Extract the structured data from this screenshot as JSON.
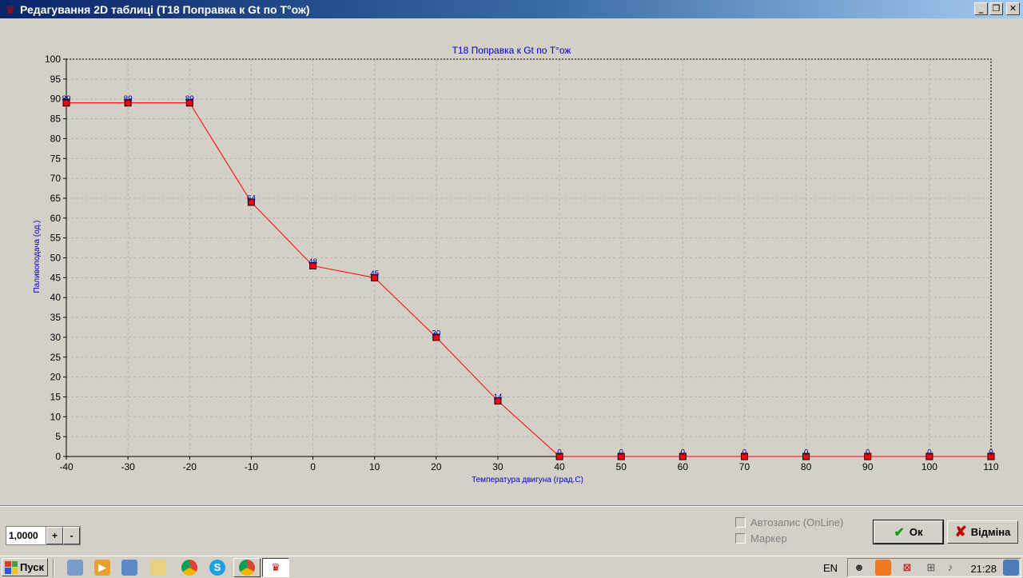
{
  "window": {
    "title": "Редагування 2D таблиці (T18 Поправка к Gt по T°ож)",
    "minimize_label": "_",
    "restore_label": "❐",
    "close_label": "✕"
  },
  "chart_data": {
    "type": "line",
    "title": "T18 Поправка к Gt по T°ож",
    "xlabel": "Температура двигуна (град.C)",
    "ylabel": "Паливоподача (од.)",
    "x": [
      -40,
      -30,
      -20,
      -10,
      0,
      10,
      20,
      30,
      40,
      50,
      60,
      70,
      80,
      90,
      100,
      110
    ],
    "values": [
      89,
      89,
      89,
      64,
      48,
      45,
      30,
      14,
      0,
      0,
      0,
      0,
      0,
      0,
      0,
      0
    ],
    "data_labels": [
      "89",
      "89",
      "89",
      "64",
      "48",
      "45",
      "30",
      "14",
      "0",
      "0",
      "0",
      "0",
      "0",
      "0",
      "0",
      "0"
    ],
    "xticks": [
      "-40",
      "-30",
      "-20",
      "-10",
      "0",
      "10",
      "20",
      "30",
      "40",
      "50",
      "60",
      "70",
      "80",
      "90",
      "100",
      "110"
    ],
    "yticks": [
      "0",
      "5",
      "10",
      "15",
      "20",
      "25",
      "30",
      "35",
      "40",
      "45",
      "50",
      "55",
      "60",
      "65",
      "70",
      "75",
      "80",
      "85",
      "90",
      "95",
      "100"
    ],
    "xlim": [
      -40,
      110
    ],
    "ylim": [
      0,
      100
    ],
    "grid": true,
    "line_color": "#ff0000",
    "marker_color": "#ff0000",
    "label_color": "#0000a0",
    "title_color": "#0000c0"
  },
  "controls": {
    "scale_value": "1,0000",
    "plus_label": "+",
    "minus_label": "-",
    "autosave_label": "Автозапис (OnLine)",
    "marker_label": "Маркер",
    "ok_label": "Ок",
    "cancel_label": "Відміна"
  },
  "taskbar": {
    "start_label": "Пуск",
    "language": "EN",
    "clock": "21:28"
  }
}
